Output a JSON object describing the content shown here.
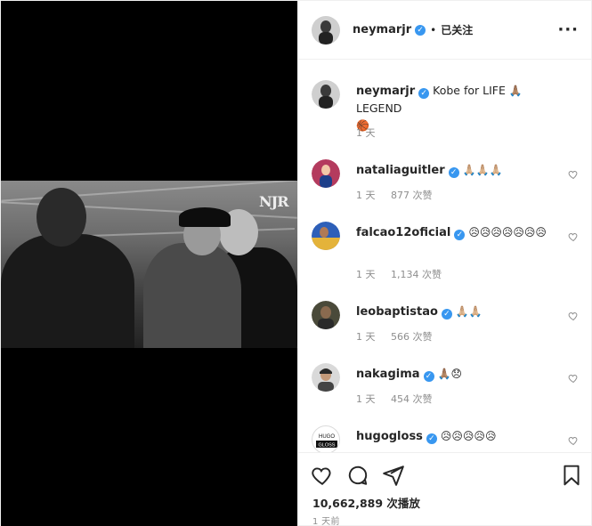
{
  "post": {
    "username": "neymarjr",
    "follow_label": "已关注",
    "watermark": "NJR"
  },
  "caption": {
    "username": "neymarjr",
    "text": "Kobe for LIFE",
    "emoji_pray": "🙏🏽",
    "text2": "LEGEND",
    "emoji_ball": "🏀",
    "time": "1 天"
  },
  "comments": [
    {
      "username": "nataliaguitler",
      "emoji": "🙏🏼🙏🏼🙏🏼",
      "time": "1 天",
      "likes": "877 次赞",
      "avatar_color": "#b43b5e"
    },
    {
      "username": "falcao12oficial",
      "emoji": "😥😥😥😥😥😥😥",
      "time": "1 天",
      "likes": "1,134 次赞",
      "avatar_color": "#2d5fb8"
    },
    {
      "username": "leobaptistao",
      "emoji": "🙏🏼🙏🏼",
      "time": "1 天",
      "likes": "566 次赞",
      "avatar_color": "#4a4a3a"
    },
    {
      "username": "nakagima",
      "emoji": "🙏🏽😞",
      "time": "1 天",
      "likes": "454 次赞",
      "avatar_color": "#6b5a4a"
    },
    {
      "username": "hugogloss",
      "emoji": "😥😥😥😥😥",
      "time": "",
      "likes": "",
      "avatar_color": "#111111",
      "avatar_text_top": "HUGO",
      "avatar_text_bottom": "GLOSS"
    }
  ],
  "actions": {
    "views": "10,662,889 次播放",
    "ago": "1 天前"
  },
  "icons": {
    "like": "heart-icon",
    "comment": "comment-icon",
    "share": "share-icon",
    "save": "bookmark-icon",
    "more": "more-options-icon"
  },
  "colors": {
    "verified": "#3897f0",
    "meta": "#8e8e8e",
    "border": "#efefef"
  }
}
